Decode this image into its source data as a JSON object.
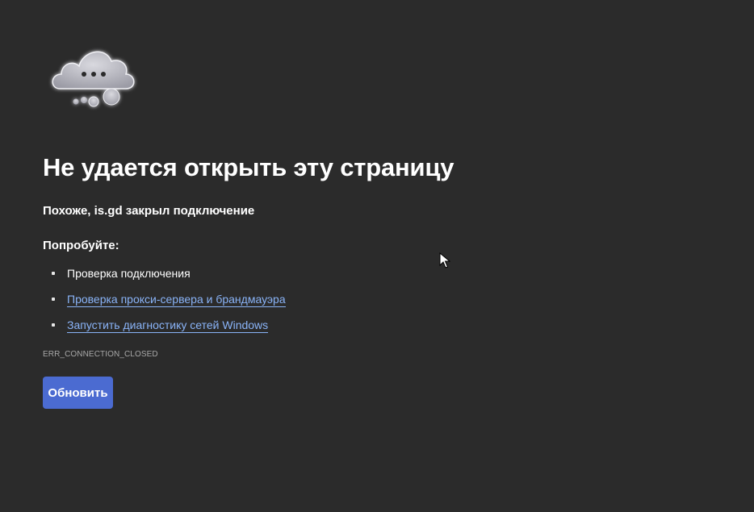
{
  "error_page": {
    "icon": "cloud-error-icon",
    "headline": "Не удается открыть эту страницу",
    "subheadline_prefix": "Похоже, ",
    "subheadline_host": "is.gd",
    "subheadline_suffix": " закрыл подключение",
    "try_heading": "Попробуйте:",
    "suggestions": [
      {
        "label": "Проверка подключения",
        "link": false
      },
      {
        "label": "Проверка прокси-сервера и брандмауэра",
        "link": true
      },
      {
        "label": "Запустить диагностику сетей Windows",
        "link": true
      }
    ],
    "error_code": "ERR_CONNECTION_CLOSED",
    "refresh_label": "Обновить"
  },
  "colors": {
    "background": "#2b2b2b",
    "link": "#8ab4f8",
    "button": "#4b6bd1",
    "text": "#ffffff",
    "muted": "#a8a8a8"
  },
  "pointer_icon": "mouse-cursor-icon"
}
